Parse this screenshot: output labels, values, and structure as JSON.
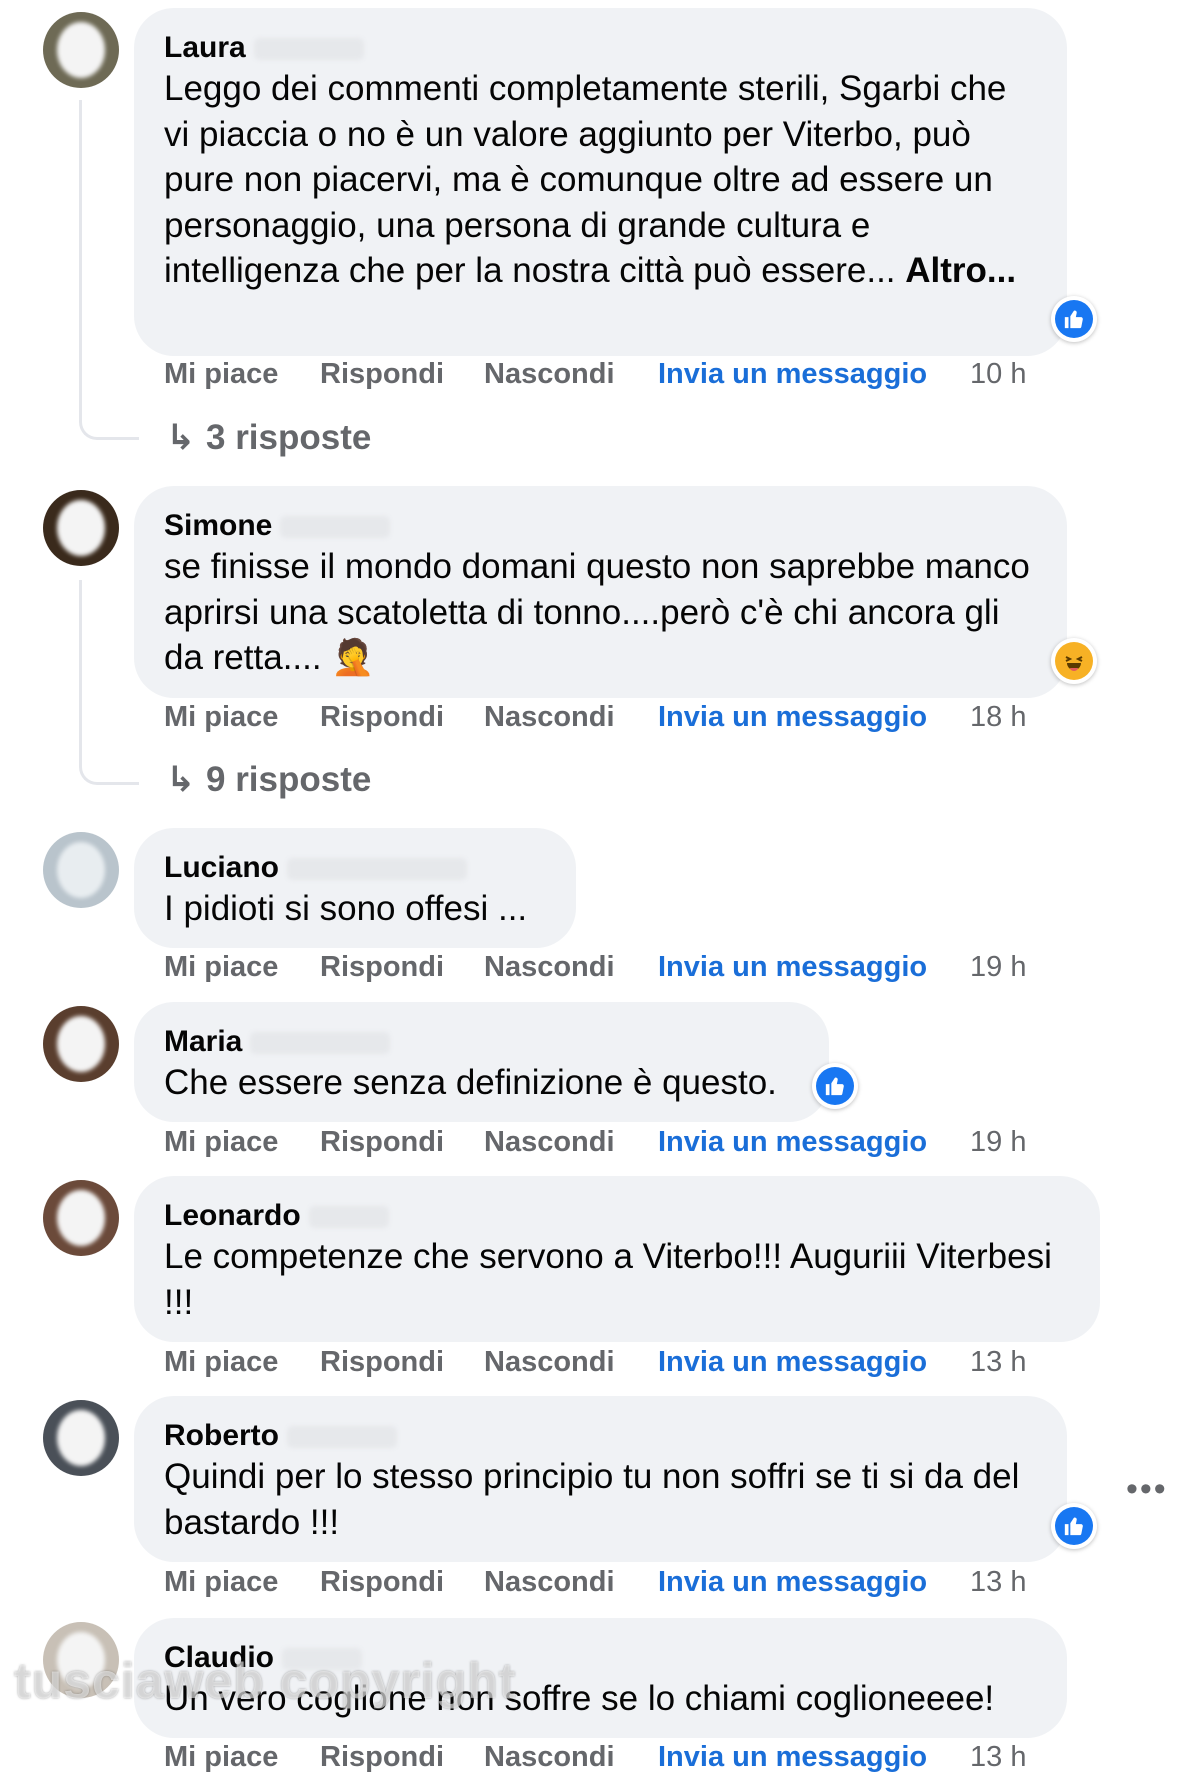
{
  "actions": {
    "like": "Mi piace",
    "reply": "Rispondi",
    "hide": "Nascondi",
    "message": "Invia un messaggio"
  },
  "comments": [
    {
      "author": "Laura",
      "text": "Leggo dei commenti completamente sterili, Sgarbi che vi piaccia o no è un valore aggiunto per Viterbo, può pure non piacervi, ma è comunque oltre ad essere un personaggio, una persona di grande cultura e intelligenza che per la nostra città può essere...",
      "more": "Altro...",
      "time": "10 h",
      "reaction": "like-icon",
      "replies": "3 risposte"
    },
    {
      "author": "Simone",
      "text": "se finisse il mondo domani questo non saprebbe manco aprirsi una scatoletta di tonno....però c'è chi ancora gli da retta.... 🤦",
      "time": "18 h",
      "reaction": "haha-icon",
      "replies": "9 risposte"
    },
    {
      "author": "Luciano",
      "text": "I pidioti si sono offesi ...",
      "time": "19 h"
    },
    {
      "author": "Maria",
      "text": "Che essere senza definizione è questo.",
      "time": "19 h",
      "reaction": "like-icon"
    },
    {
      "author": "Leonardo",
      "text": "Le competenze che servono a Viterbo!!! Auguriii Viterbesi !!!",
      "time": "13 h"
    },
    {
      "author": "Roberto",
      "text": "Quindi per lo stesso principio tu non soffri se ti si da del bastardo !!!",
      "time": "13 h",
      "reaction": "like-icon"
    },
    {
      "author": "Claudio",
      "text": "Un vero coglione non soffre se lo chiami coglioneeee!",
      "time": "13 h"
    }
  ],
  "more_options": "•••",
  "watermark": "tusciaweb copyright",
  "colors": {
    "bubble": "#f0f2f5",
    "link": "#1a6ed8",
    "muted": "#65676b",
    "like": "#1877f2",
    "haha": "#f7b125"
  }
}
